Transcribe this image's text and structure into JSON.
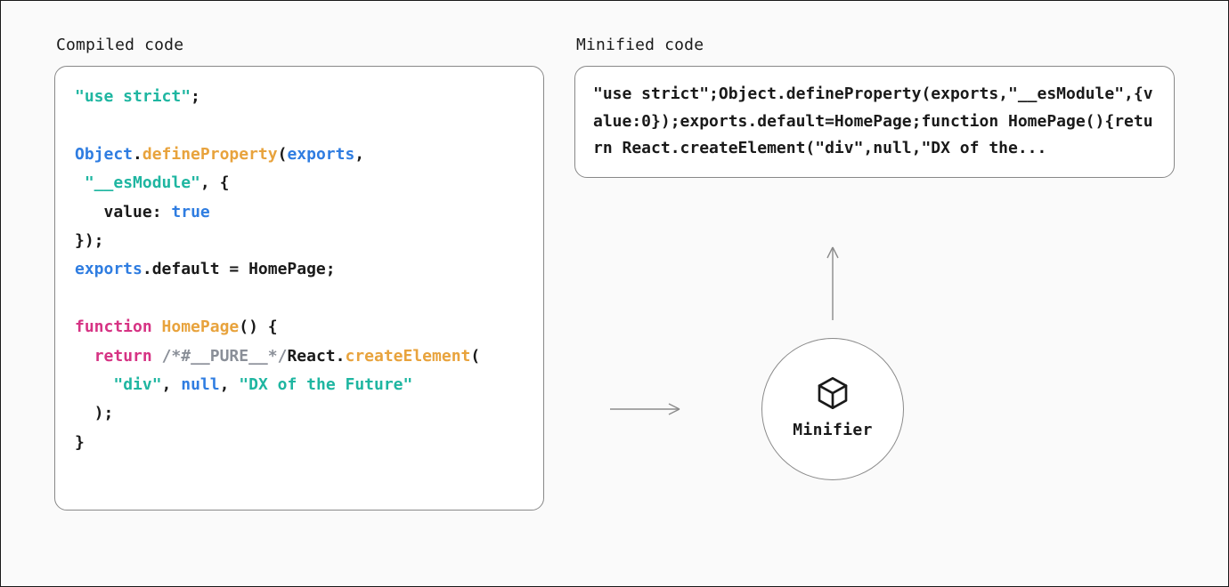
{
  "leftTitle": "Compiled code",
  "rightTitle": "Minified code",
  "compiledTokens": [
    {
      "t": "\"use strict\"",
      "c": "tk-str"
    },
    {
      "t": ";",
      "c": "tk-punc"
    },
    {
      "t": "\n\n"
    },
    {
      "t": "Object",
      "c": "tk-obj"
    },
    {
      "t": ".",
      "c": "tk-punc"
    },
    {
      "t": "defineProperty",
      "c": "tk-meth"
    },
    {
      "t": "(",
      "c": "tk-punc"
    },
    {
      "t": "exports",
      "c": "tk-id"
    },
    {
      "t": ",",
      "c": "tk-punc"
    },
    {
      "t": "\n"
    },
    {
      "t": " ",
      "c": "tk-plain"
    },
    {
      "t": "\"__esModule\"",
      "c": "tk-str"
    },
    {
      "t": ", {",
      "c": "tk-punc"
    },
    {
      "t": "\n"
    },
    {
      "t": "   value",
      "c": "tk-plain"
    },
    {
      "t": ": ",
      "c": "tk-punc"
    },
    {
      "t": "true",
      "c": "tk-bool"
    },
    {
      "t": "\n"
    },
    {
      "t": "});",
      "c": "tk-punc"
    },
    {
      "t": "\n"
    },
    {
      "t": "exports",
      "c": "tk-id"
    },
    {
      "t": ".default = HomePage;",
      "c": "tk-plain"
    },
    {
      "t": "\n\n"
    },
    {
      "t": "function",
      "c": "tk-kw"
    },
    {
      "t": " ",
      "c": "tk-plain"
    },
    {
      "t": "HomePage",
      "c": "tk-fn"
    },
    {
      "t": "() {",
      "c": "tk-punc"
    },
    {
      "t": "\n"
    },
    {
      "t": "  ",
      "c": "tk-plain"
    },
    {
      "t": "return",
      "c": "tk-kw"
    },
    {
      "t": " ",
      "c": "tk-plain"
    },
    {
      "t": "/*#__PURE__*/",
      "c": "tk-comm"
    },
    {
      "t": "React.",
      "c": "tk-plain"
    },
    {
      "t": "createElement",
      "c": "tk-meth"
    },
    {
      "t": "(",
      "c": "tk-punc"
    },
    {
      "t": "\n"
    },
    {
      "t": "    ",
      "c": "tk-plain"
    },
    {
      "t": "\"div\"",
      "c": "tk-str"
    },
    {
      "t": ", ",
      "c": "tk-punc"
    },
    {
      "t": "null",
      "c": "tk-bool"
    },
    {
      "t": ", ",
      "c": "tk-punc"
    },
    {
      "t": "\"DX of the Future\"",
      "c": "tk-str"
    },
    {
      "t": "\n"
    },
    {
      "t": "  );",
      "c": "tk-punc"
    },
    {
      "t": "\n"
    },
    {
      "t": "}",
      "c": "tk-punc"
    }
  ],
  "minified": "\"use strict\";Object.defineProperty(exports,\"__esModule\",{value:0});exports.default=HomePage;function HomePage(){return React.createElement(\"div\",null,\"DX of the...",
  "minifierLabel": "Minifier"
}
